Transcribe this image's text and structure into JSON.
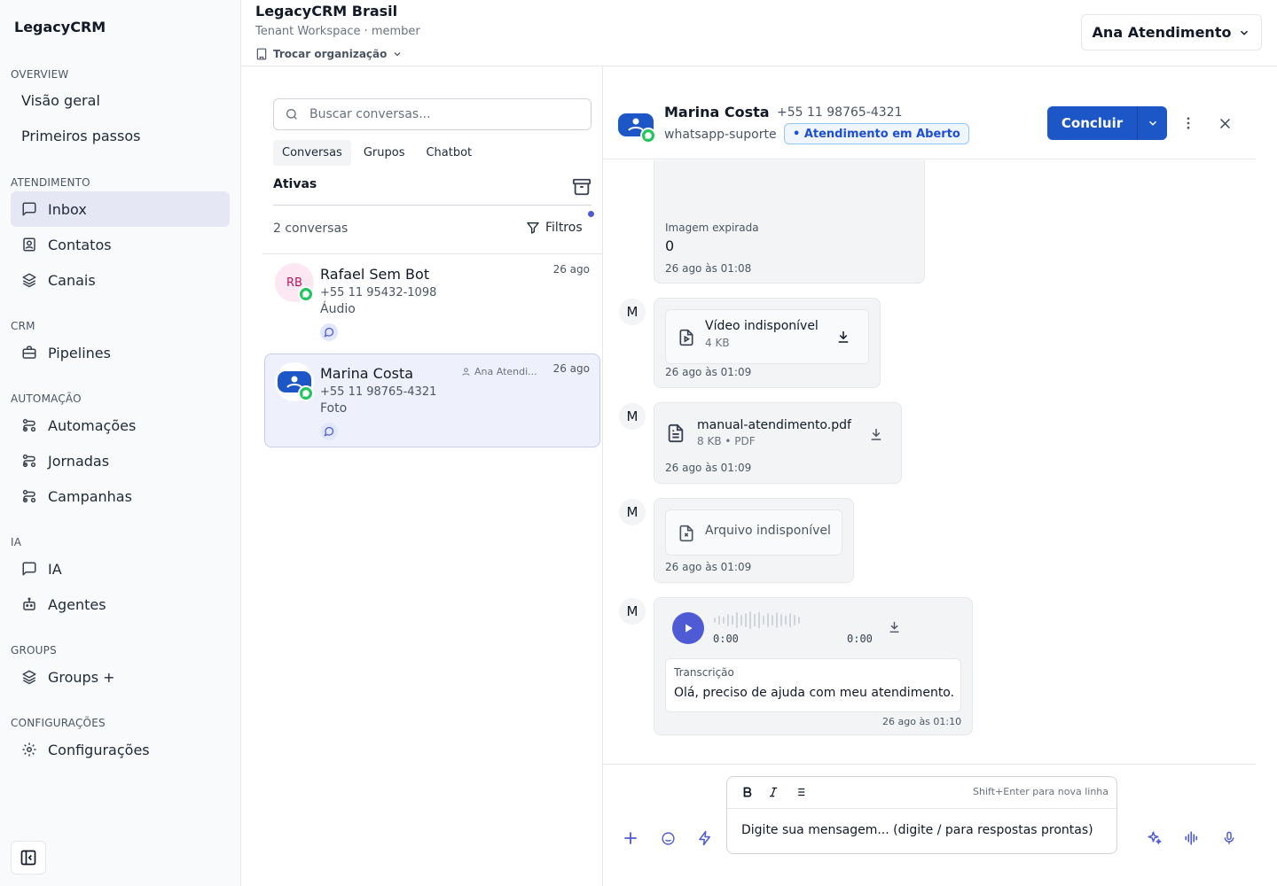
{
  "sidebar": {
    "brand": "LegacyCRM",
    "sections": {
      "overview": "OVERVIEW",
      "atendimento": "ATENDIMENTO",
      "crm": "CRM",
      "automacao": "AUTOMAÇÃO",
      "ia": "IA",
      "groups": "GROUPS",
      "config": "CONFIGURAÇÕES"
    },
    "items": {
      "visao_geral": "Visão geral",
      "primeiros_passos": "Primeiros passos",
      "inbox": "Inbox",
      "contatos": "Contatos",
      "canais": "Canais",
      "pipelines": "Pipelines",
      "automacoes": "Automações",
      "jornadas": "Jornadas",
      "campanhas": "Campanhas",
      "ia": "IA",
      "agentes": "Agentes",
      "groups_plus": "Groups +",
      "configuracoes": "Configurações"
    },
    "active_item": "inbox"
  },
  "header": {
    "org_title": "LegacyCRM Brasil",
    "org_subtitle": "Tenant Workspace · member",
    "switch_org": "Trocar organização",
    "user": "Ana Atendimento"
  },
  "conversations": {
    "search_placeholder": "Buscar conversas...",
    "tabs": [
      "Conversas",
      "Grupos",
      "Chatbot"
    ],
    "active_tab": "Conversas",
    "section_label": "Ativas",
    "count": "2 conversas",
    "filters": "Filtros",
    "items": [
      {
        "initials": "RB",
        "name": "Rafael Sem Bot",
        "phone": "+55 11 95432-1098",
        "preview": "Áudio",
        "date": "26 ago",
        "assignee": ""
      },
      {
        "initials": "",
        "name": "Marina Costa",
        "phone": "+55 11 98765-4321",
        "preview": "Foto",
        "date": "26 ago",
        "assignee": "Ana Atendi..."
      }
    ]
  },
  "chat": {
    "contact_name": "Marina Costa",
    "contact_phone": "+55 11 98765-4321",
    "channel": "whatsapp-suporte",
    "status": "• Atendimento em Aberto",
    "conclude": "Concluir",
    "messages": {
      "expired": {
        "label": "Imagem expirada",
        "value": "0",
        "time": "26 ago às 01:08"
      },
      "video": {
        "sender": "M",
        "title": "Vídeo indisponível",
        "meta": "4 KB",
        "time": "26 ago às 01:09"
      },
      "pdf": {
        "sender": "M",
        "title": "manual-atendimento.pdf",
        "meta": "8 KB • PDF",
        "time": "26 ago às 01:09"
      },
      "file": {
        "sender": "M",
        "title": "Arquivo indisponível",
        "time": "26 ago às 01:09"
      },
      "audio": {
        "sender": "M",
        "current": "0:00",
        "duration": "0:00",
        "transcription_label": "Transcrição",
        "transcription": "Olá, preciso de ajuda com meu atendimento.",
        "time": "26 ago às 01:10"
      }
    }
  },
  "composer": {
    "hint": "Shift+Enter para nova linha",
    "placeholder": "Digite sua mensagem... (digite / para respostas prontas)"
  },
  "colors": {
    "accent": "#4f5bd5",
    "primary": "#1d56c7",
    "whatsapp": "#22c55e"
  }
}
